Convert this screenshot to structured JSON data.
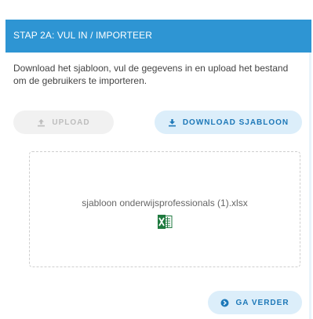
{
  "panel": {
    "title": "STAP 2A: VUL IN / IMPORTEER",
    "intro": "Download het sjabloon, vul de gegevens in en upload het bestand om de gebruikers te importeren."
  },
  "buttons": {
    "upload": "UPLOAD",
    "download": "DOWNLOAD SJABLOON",
    "next": "GA VERDER"
  },
  "dropzone": {
    "file_name": "sjabloon onderwijsprofessionals (1).xlsx",
    "file_icon": "excel-file-icon"
  },
  "colors": {
    "header": "#2e95d3",
    "panel_bg": "#e9f4fb",
    "accent": "#1d78b8",
    "excel_green": "#1f7a3f"
  }
}
